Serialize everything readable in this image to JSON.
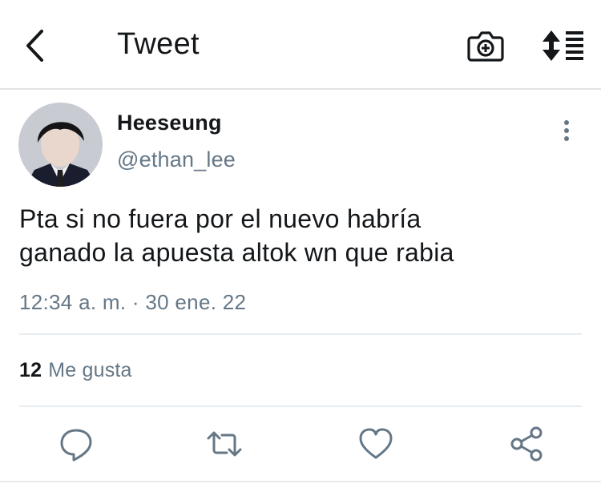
{
  "header": {
    "title": "Tweet",
    "back_icon": "chevron-left-icon",
    "camera_icon": "camera-plus-icon",
    "sort_icon": "sort-list-icon"
  },
  "tweet": {
    "author_name": "Heeseung",
    "author_handle": "@ethan_lee",
    "text_line1": "Pta si no fuera por el nuevo habría",
    "text_line2": "ganado la apuesta altok wn que rabia",
    "timestamp": "12:34 a. m. · 30 ene. 22",
    "likes_count": "12",
    "likes_label": "Me gusta"
  },
  "actions": [
    "reply-icon",
    "retweet-icon",
    "like-icon",
    "share-icon"
  ],
  "colors": {
    "text": "#14171a",
    "secondary": "#657786",
    "divider": "#e6ecf0"
  }
}
